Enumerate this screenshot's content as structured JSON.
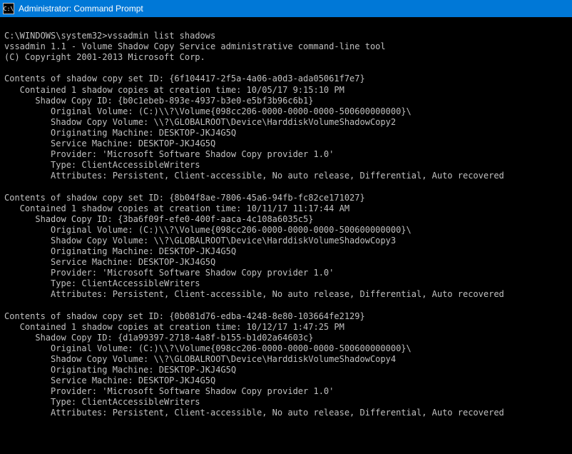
{
  "window": {
    "title": "Administrator: Command Prompt",
    "icon_glyph": "C:\\"
  },
  "prompt": {
    "path": "C:\\WINDOWS\\system32>",
    "command": "vssadmin list shadows"
  },
  "header": {
    "tool_line": "vssadmin 1.1 - Volume Shadow Copy Service administrative command-line tool",
    "copyright": "(C) Copyright 2001-2013 Microsoft Corp."
  },
  "sets": [
    {
      "set_line": "Contents of shadow copy set ID: {6f104417-2f5a-4a06-a0d3-ada05061f7e7}",
      "contained": "Contained 1 shadow copies at creation time: 10/05/17 9:15:10 PM",
      "copy_id": "Shadow Copy ID: {b0c1ebeb-893e-4937-b3e0-e5bf3b96c6b1}",
      "orig": "Original Volume: (C:)\\\\?\\Volume{098cc206-0000-0000-0000-500600000000}\\",
      "vol": "Shadow Copy Volume: \\\\?\\GLOBALROOT\\Device\\HarddiskVolumeShadowCopy2",
      "om": "Originating Machine: DESKTOP-JKJ4G5Q",
      "sm": "Service Machine: DESKTOP-JKJ4G5Q",
      "prov": "Provider: 'Microsoft Software Shadow Copy provider 1.0'",
      "type": "Type: ClientAccessibleWriters",
      "attr": "Attributes: Persistent, Client-accessible, No auto release, Differential, Auto recovered"
    },
    {
      "set_line": "Contents of shadow copy set ID: {8b04f8ae-7806-45a6-94fb-fc82ce171027}",
      "contained": "Contained 1 shadow copies at creation time: 10/11/17 11:17:44 AM",
      "copy_id": "Shadow Copy ID: {3ba6f09f-efe0-400f-aaca-4c108a6035c5}",
      "orig": "Original Volume: (C:)\\\\?\\Volume{098cc206-0000-0000-0000-500600000000}\\",
      "vol": "Shadow Copy Volume: \\\\?\\GLOBALROOT\\Device\\HarddiskVolumeShadowCopy3",
      "om": "Originating Machine: DESKTOP-JKJ4G5Q",
      "sm": "Service Machine: DESKTOP-JKJ4G5Q",
      "prov": "Provider: 'Microsoft Software Shadow Copy provider 1.0'",
      "type": "Type: ClientAccessibleWriters",
      "attr": "Attributes: Persistent, Client-accessible, No auto release, Differential, Auto recovered"
    },
    {
      "set_line": "Contents of shadow copy set ID: {0b081d76-edba-4248-8e80-103664fe2129}",
      "contained": "Contained 1 shadow copies at creation time: 10/12/17 1:47:25 PM",
      "copy_id": "Shadow Copy ID: {d1a99397-2718-4a8f-b155-b1d02a64603c}",
      "orig": "Original Volume: (C:)\\\\?\\Volume{098cc206-0000-0000-0000-500600000000}\\",
      "vol": "Shadow Copy Volume: \\\\?\\GLOBALROOT\\Device\\HarddiskVolumeShadowCopy4",
      "om": "Originating Machine: DESKTOP-JKJ4G5Q",
      "sm": "Service Machine: DESKTOP-JKJ4G5Q",
      "prov": "Provider: 'Microsoft Software Shadow Copy provider 1.0'",
      "type": "Type: ClientAccessibleWriters",
      "attr": "Attributes: Persistent, Client-accessible, No auto release, Differential, Auto recovered"
    }
  ]
}
